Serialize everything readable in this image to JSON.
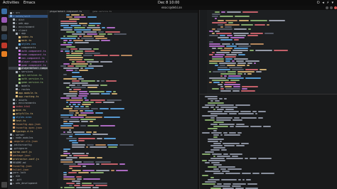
{
  "topbar": {
    "activities": "Activities",
    "app_name": "Emacs",
    "clock": "Dec 8  10:00",
    "tray": "⏻ ◂ ⚡ ▾"
  },
  "window": {
    "title": "emacs@debian"
  },
  "file_tree": {
    "items": [
      {
        "label": "▾ src",
        "level": 0,
        "color": "#a8b0b8"
      },
      {
        "label": "▾ notes/unit",
        "level": 0,
        "color": "#7aa6da",
        "highlight": "sel"
      },
      {
        "label": "▸ dist",
        "level": 1,
        "color": "#a8b0b8"
      },
      {
        "label": "▸ web-app",
        "level": 1,
        "color": "#a8b0b8"
      },
      {
        "label": "▸ environment",
        "level": 1,
        "color": "#a8b0b8"
      },
      {
        "label": "▾ client",
        "level": 1,
        "color": "#a8b0b8"
      },
      {
        "label": "▾ app",
        "level": 2,
        "color": "#a8b0b8"
      },
      {
        "label": "index.ts",
        "level": 3,
        "color": "#e5c07b"
      },
      {
        "label": "main.ts",
        "level": 3,
        "color": "#e5c07b"
      },
      {
        "label": "styles.css",
        "level": 3,
        "color": "#61afef"
      },
      {
        "label": "▾ components",
        "level": 2,
        "color": "#a8b0b8"
      },
      {
        "label": "auth.component.ts",
        "level": 3,
        "color": "#c678dd"
      },
      {
        "label": "home.component.ts",
        "level": 3,
        "color": "#c678dd"
      },
      {
        "label": "nav.component.ts",
        "level": 3,
        "color": "#c678dd"
      },
      {
        "label": "player.component.ts",
        "level": 3,
        "color": "#c678dd"
      },
      {
        "label": "game.component.ts",
        "level": 3,
        "color": "#c678dd"
      },
      {
        "label": "playerdetail.component.ts",
        "level": 3,
        "color": "#ffffff",
        "highlight": "hl"
      },
      {
        "label": "▾ services",
        "level": 2,
        "color": "#a8b0b8"
      },
      {
        "label": "api.service.ts",
        "level": 3,
        "color": "#98c379"
      },
      {
        "label": "auth.service.ts",
        "level": 3,
        "color": "#98c379"
      },
      {
        "label": "game.service.ts",
        "level": 3,
        "color": "#98c379"
      },
      {
        "label": "▸ models",
        "level": 2,
        "color": "#a8b0b8"
      },
      {
        "label": "▸ routes",
        "level": 2,
        "color": "#a8b0b8"
      },
      {
        "label": "app.module.ts",
        "level": 2,
        "color": "#e5c07b"
      },
      {
        "label": "app.routing.ts",
        "level": 2,
        "color": "#e5c07b"
      },
      {
        "label": "▸ assets",
        "level": 1,
        "color": "#a8b0b8"
      },
      {
        "label": "▸ environments",
        "level": 1,
        "color": "#a8b0b8"
      },
      {
        "label": "index.html",
        "level": 1,
        "color": "#e06c75"
      },
      {
        "label": "main.ts",
        "level": 1,
        "color": "#e5c07b"
      },
      {
        "label": "polyfills.ts",
        "level": 1,
        "color": "#e5c07b"
      },
      {
        "label": "styles.scss",
        "level": 1,
        "color": "#61afef"
      },
      {
        "label": "test.ts",
        "level": 1,
        "color": "#e5c07b"
      },
      {
        "label": "tsconfig.app.json",
        "level": 1,
        "color": "#d19a66"
      },
      {
        "label": "tsconfig.spec.json",
        "level": 1,
        "color": "#d19a66"
      },
      {
        "label": "typings.d.ts",
        "level": 1,
        "color": "#e5c07b"
      },
      {
        "label": "▸ server",
        "level": 0,
        "color": "#a8b0b8"
      },
      {
        "label": "▸ node_modules",
        "level": 0,
        "color": "#a8b0b8"
      },
      {
        "label": ".angular-cli.json",
        "level": 0,
        "color": "#d19a66"
      },
      {
        "label": ".editorconfig",
        "level": 0,
        "color": "#a8b0b8"
      },
      {
        "label": ".gitignore",
        "level": 0,
        "color": "#a8b0b8"
      },
      {
        "label": "karma.conf.js",
        "level": 0,
        "color": "#e5c07b"
      },
      {
        "label": "package.json",
        "level": 0,
        "color": "#d19a66"
      },
      {
        "label": "protractor.conf.js",
        "level": 0,
        "color": "#e5c07b"
      },
      {
        "label": "README.md",
        "level": 0,
        "color": "#a8b0b8"
      },
      {
        "label": "tsconfig.json",
        "level": 0,
        "color": "#d19a66"
      },
      {
        "label": "tslint.json",
        "level": 0,
        "color": "#d19a66"
      },
      {
        "label": "yarn.lock",
        "level": 0,
        "color": "#a8b0b8"
      },
      {
        "label": "▸ e2e",
        "level": 0,
        "color": "#a8b0b8"
      },
      {
        "label": "▸ .git",
        "level": 0,
        "color": "#a8b0b8"
      },
      {
        "label": "▸ web_development",
        "level": 0,
        "color": "#a8b0b8"
      }
    ]
  },
  "editor_tabs": [
    {
      "label": "playerdetail.component.ts",
      "active": true
    },
    {
      "label": "game.service.ts",
      "active": false
    }
  ],
  "colors": {
    "keyword": "#c678dd",
    "string": "#98c379",
    "func": "#61afef",
    "type": "#e5c07b",
    "comment": "#5c6370",
    "plain": "#abb2bf",
    "number": "#d19a66",
    "red": "#e06c75",
    "term_text": "#9da5b4",
    "term_prompt": "#98c379"
  }
}
